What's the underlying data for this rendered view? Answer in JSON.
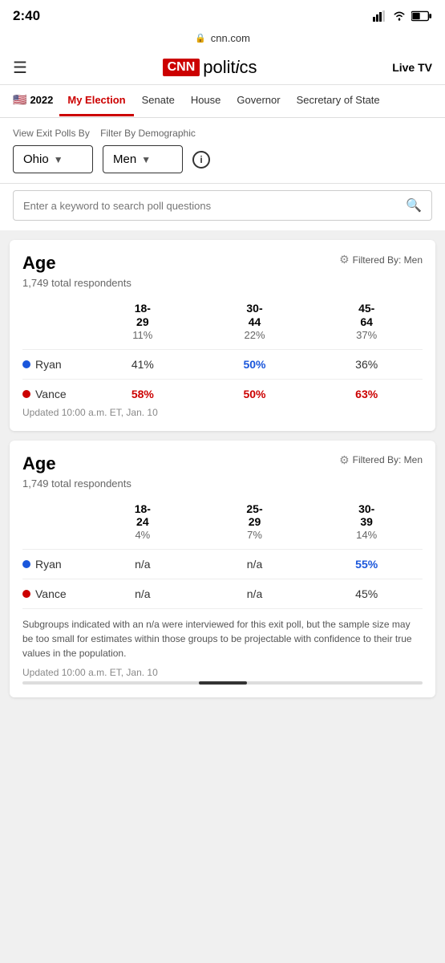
{
  "statusBar": {
    "time": "2:40",
    "url": "cnn.com"
  },
  "nav": {
    "logo": "CNN",
    "politics": "politics",
    "liveTV": "Live TV"
  },
  "tabs": {
    "year": "2022",
    "items": [
      {
        "label": "My Election",
        "active": true
      },
      {
        "label": "Senate",
        "active": false
      },
      {
        "label": "House",
        "active": false
      },
      {
        "label": "Governor",
        "active": false
      },
      {
        "label": "Secretary of State",
        "active": false
      }
    ]
  },
  "filters": {
    "viewLabel": "View Exit Polls By",
    "filterLabel": "Filter By Demographic",
    "location": "Ohio",
    "demographic": "Men"
  },
  "search": {
    "placeholder": "Enter a keyword to search poll questions"
  },
  "card1": {
    "title": "Age",
    "filteredBy": "Filtered By: Men",
    "totalRespondents": "1,749 total respondents",
    "columns": [
      {
        "range": "18-\n29",
        "pct": "11%"
      },
      {
        "range": "30-\n44",
        "pct": "22%"
      },
      {
        "range": "45-\n64",
        "pct": "37%"
      }
    ],
    "candidates": [
      {
        "name": "Ryan",
        "color": "blue",
        "values": [
          "41%",
          "50%",
          "36%"
        ],
        "highlights": [
          false,
          true,
          false
        ]
      },
      {
        "name": "Vance",
        "color": "red",
        "values": [
          "58%",
          "50%",
          "63%"
        ],
        "highlights": [
          true,
          true,
          true
        ]
      }
    ],
    "updated": "Updated 10:00 a.m. ET, Jan. 10"
  },
  "card2": {
    "title": "Age",
    "filteredBy": "Filtered By: Men",
    "totalRespondents": "1,749 total respondents",
    "columns": [
      {
        "range": "18-\n24",
        "pct": "4%"
      },
      {
        "range": "25-\n29",
        "pct": "7%"
      },
      {
        "range": "30-\n39",
        "pct": "14%"
      }
    ],
    "candidates": [
      {
        "name": "Ryan",
        "color": "blue",
        "values": [
          "n/a",
          "n/a",
          "55%"
        ],
        "highlights": [
          false,
          false,
          true
        ]
      },
      {
        "name": "Vance",
        "color": "red",
        "values": [
          "n/a",
          "n/a",
          "45%"
        ],
        "highlights": [
          false,
          false,
          false
        ]
      }
    ],
    "footnote": "Subgroups indicated with an n/a were interviewed for this exit poll, but the sample size may be too small for estimates within those groups to be projectable with confidence to their true values in the population.",
    "updated": "Updated 10:00 a.m. ET, Jan. 10"
  }
}
